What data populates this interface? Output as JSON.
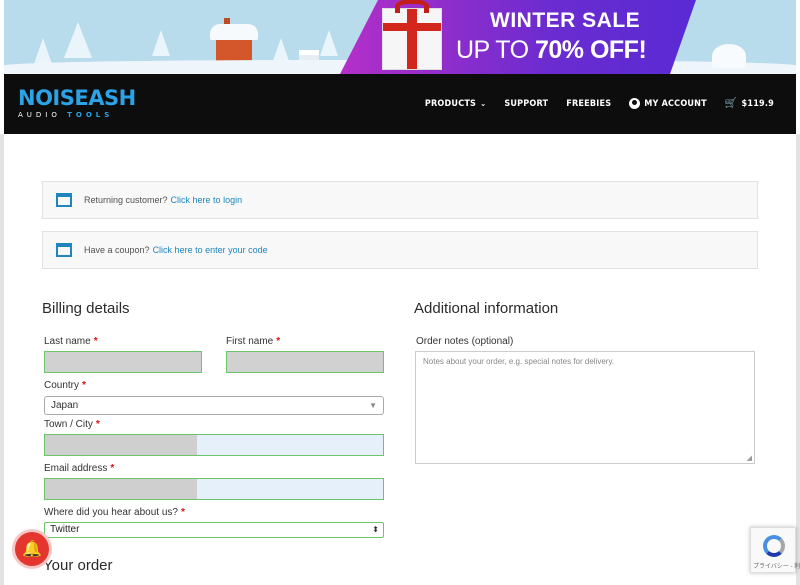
{
  "banner": {
    "title": "WINTER SALE",
    "subtitle_prefix": "UP TO ",
    "subtitle_bold": "70% OFF!"
  },
  "header": {
    "logo_main_a": "NOISE",
    "logo_main_b": "ASH",
    "logo_sub_a": "AUDIO ",
    "logo_sub_b": "TOOLS",
    "nav": {
      "products": "PRODUCTS",
      "support": "SUPPORT",
      "freebies": "FREEBIES",
      "account": "MY ACCOUNT",
      "cart": "$119.9"
    }
  },
  "notices": {
    "returning_text": "Returning customer?",
    "returning_link": "Click here to login",
    "coupon_text": "Have a coupon?",
    "coupon_link": "Click here to enter your code"
  },
  "billing": {
    "heading": "Billing details",
    "last_name_label": "Last name",
    "first_name_label": "First name",
    "country_label": "Country",
    "country_value": "Japan",
    "town_label": "Town / City",
    "email_label": "Email address",
    "hear_label": "Where did you hear about us?",
    "hear_value": "Twitter",
    "required_mark": "*"
  },
  "additional": {
    "heading": "Additional information",
    "notes_label": "Order notes (optional)",
    "notes_placeholder": "Notes about your order, e.g. special notes for delivery."
  },
  "order": {
    "heading": "Your order"
  },
  "recaptcha": {
    "text": "プライバシー - 利用規約"
  },
  "colors": {
    "accent": "#1e85be",
    "required": "#dd1111",
    "valid_border": "#6cc46b",
    "header_bg": "#0d0d0d"
  }
}
